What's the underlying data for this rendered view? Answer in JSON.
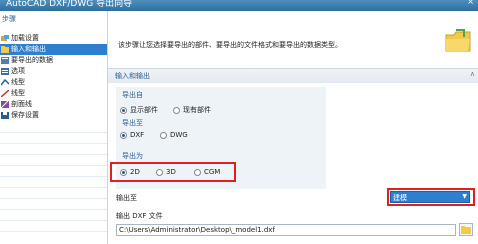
{
  "window": {
    "title": "AutoCAD DXF/DWG 导出向导",
    "close_glyph": "×"
  },
  "sidebar": {
    "heading": "步骤",
    "items": [
      {
        "label": "加载设置",
        "icon": "load-settings-icon"
      },
      {
        "label": "输入和输出",
        "icon": "folder-icon",
        "selected": true
      },
      {
        "label": "要导出的数据",
        "icon": "data-icon"
      },
      {
        "label": "选项",
        "icon": "options-icon"
      },
      {
        "label": "线型",
        "icon": "linetype-icon"
      },
      {
        "label": "线型",
        "icon": "line-icon"
      },
      {
        "label": "剖面线",
        "icon": "hatch-icon"
      },
      {
        "label": "保存设置",
        "icon": "save-icon"
      }
    ]
  },
  "main": {
    "description": "该步骤让您选择要导出的部件、要导出的文件格式和要导出的数据类型。",
    "section_title": "输入和输出",
    "export_from": {
      "title": "导出自",
      "options": [
        "显示部件",
        "现有部件"
      ],
      "selected": 0
    },
    "export_to": {
      "title": "导出至",
      "options": [
        "DXF",
        "DWG"
      ],
      "selected": 0
    },
    "export_as": {
      "title": "导出为",
      "options": [
        "2D",
        "3D",
        "CGM"
      ],
      "selected": 0
    },
    "output_to": {
      "label": "输出至",
      "value": "建模"
    },
    "output_file": {
      "label": "输出 DXF 文件",
      "value": "C:\\Users\\Administrator\\Desktop\\_model1.dxf"
    }
  },
  "colors": {
    "accent": "#2e7fd0",
    "highlight_border": "#e02020",
    "section_text": "#2a5d8f"
  }
}
